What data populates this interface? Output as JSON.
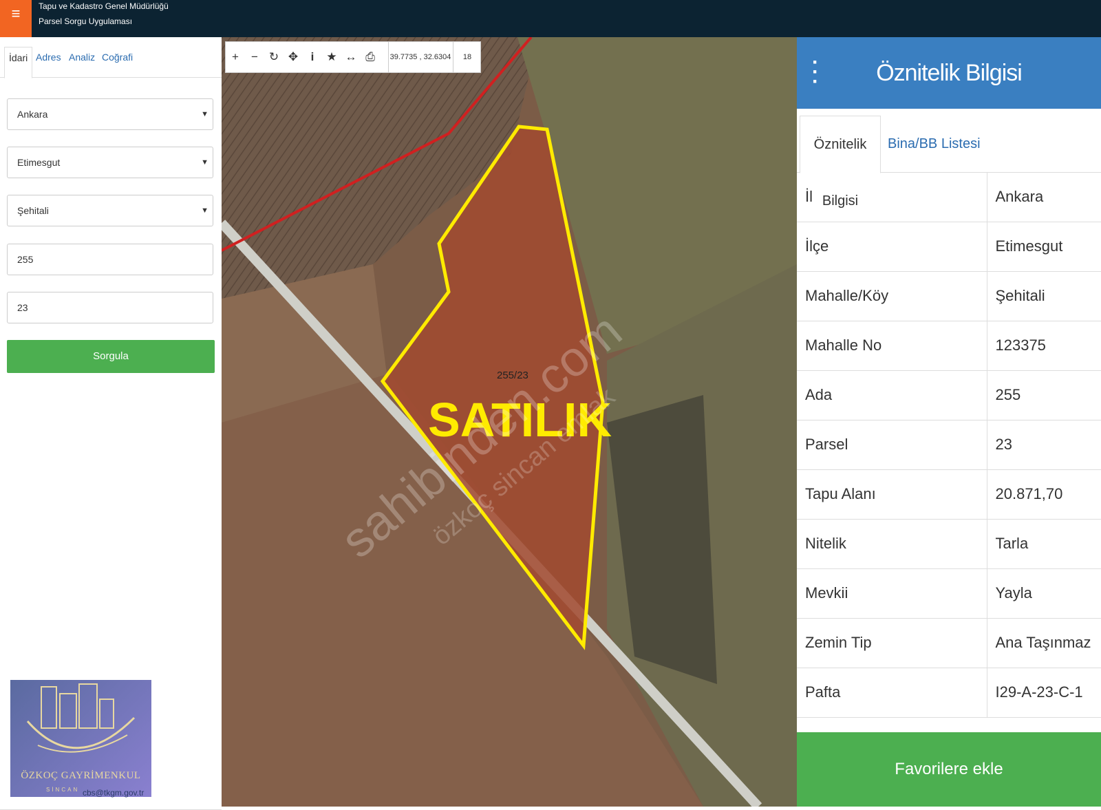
{
  "app": {
    "title_line1": "Tapu ve Kadastro Genel Müdürlüğü",
    "title_line2": "Parsel Sorgu Uygulaması",
    "menu_icon": "hamburger-icon"
  },
  "sidebar": {
    "tabs": [
      {
        "label": "İdari",
        "active": true
      },
      {
        "label": "Adres"
      },
      {
        "label": "Analiz"
      },
      {
        "label": "Coğrafi"
      }
    ],
    "fields": {
      "il": "Ankara",
      "ilce": "Etimesgut",
      "mahalle": "Şehitali",
      "ada": "255",
      "parsel": "23"
    },
    "query_button": "Sorgula",
    "footer_email": "cbs@tkgm.gov.tr"
  },
  "logo": {
    "name": "ÖZKOÇ GAYRİMENKUL",
    "sub": "SİNCAN"
  },
  "map": {
    "toolbar": {
      "icons": [
        "zoom-in-icon",
        "zoom-out-icon",
        "refresh-icon",
        "locate-icon",
        "info-icon",
        "star-icon",
        "measure-icon",
        "print-icon"
      ],
      "coords": "39.7735 , 32.6304",
      "zoom": "18"
    },
    "parcel_label": "255/23",
    "overlay_text": "SATILIK",
    "watermark": "sahibinden.com",
    "watermark2": "özkoç sincan emlak",
    "colors": {
      "parcel_outline": "#ffeb00",
      "parcel_fill": "#a0402a",
      "road": "#c8c8c8",
      "boundary_line": "#d02020"
    }
  },
  "attribute_panel": {
    "title": "Öznitelik Bilgisi",
    "tabs": [
      {
        "label": "Öznitelik Bilgisi",
        "active": true
      },
      {
        "label": "Bina/BB Listesi"
      }
    ],
    "rows": [
      {
        "key": "İl",
        "value": "Ankara"
      },
      {
        "key": "İlçe",
        "value": "Etimesgut"
      },
      {
        "key": "Mahalle/Köy",
        "value": "Şehitali"
      },
      {
        "key": "Mahalle No",
        "value": "123375"
      },
      {
        "key": "Ada",
        "value": "255"
      },
      {
        "key": "Parsel",
        "value": "23"
      },
      {
        "key": "Tapu Alanı",
        "value": "20.871,70"
      },
      {
        "key": "Nitelik",
        "value": "Tarla"
      },
      {
        "key": "Mevkii",
        "value": "Yayla"
      },
      {
        "key": "Zemin Tip",
        "value": "Ana Taşınmaz"
      },
      {
        "key": "Pafta",
        "value": "I29-A-23-C-1"
      }
    ],
    "favorite_button": "Favorilere ekle"
  }
}
